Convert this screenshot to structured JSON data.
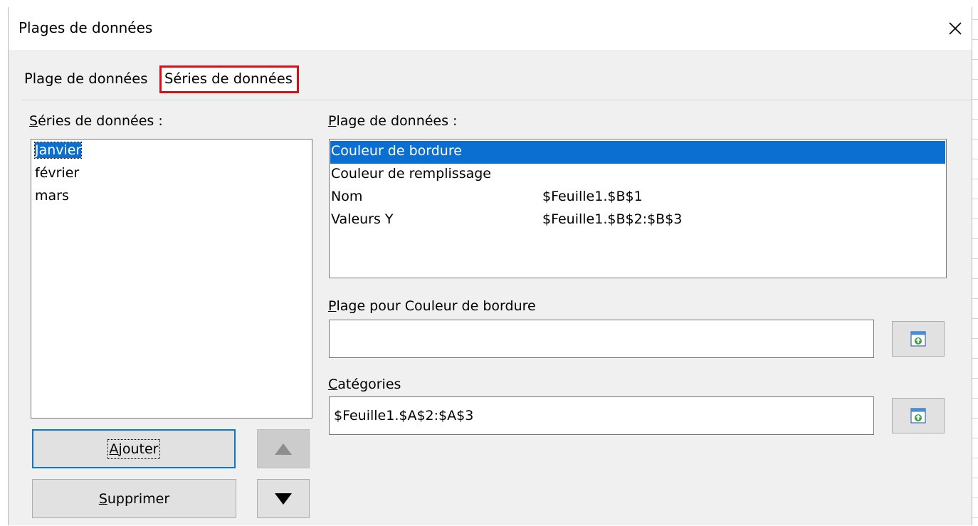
{
  "dialog": {
    "title": "Plages de données",
    "close_icon": "close-icon"
  },
  "tabs": [
    {
      "label": "Plage de données",
      "active": false
    },
    {
      "label": "Séries de données",
      "active": true
    }
  ],
  "series_panel": {
    "label_m": "S",
    "label_rest": "éries de données :",
    "items": [
      "Janvier",
      "février",
      "mars"
    ],
    "selected_index": 0
  },
  "ranges_panel": {
    "label_m": "P",
    "label_rest": "lage de données :",
    "rows": [
      {
        "role": "Couleur de bordure",
        "value": ""
      },
      {
        "role": "Couleur de remplissage",
        "value": ""
      },
      {
        "role": "Nom",
        "value": "$Feuille1.$B$1"
      },
      {
        "role": "Valeurs Y",
        "value": "$Feuille1.$B$2:$B$3"
      }
    ],
    "selected_index": 0
  },
  "range_for": {
    "label_m": "P",
    "label_rest": "lage pour Couleur de bordure",
    "value": ""
  },
  "categories": {
    "label_m": "C",
    "label_rest": "atégories",
    "value": "$Feuille1.$A$2:$A$3"
  },
  "buttons": {
    "add_m": "A",
    "add_rest": "jouter",
    "remove_m": "S",
    "remove_rest": "upprimer"
  },
  "colors": {
    "selection": "#0b6fd2",
    "highlight_box": "#d6111a",
    "focus": "#0b78d0"
  }
}
